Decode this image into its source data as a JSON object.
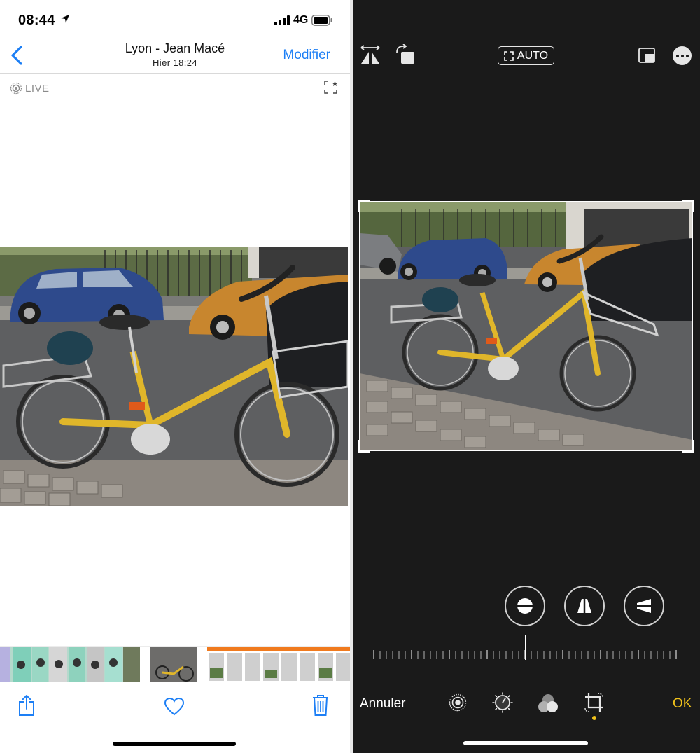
{
  "left": {
    "status": {
      "time": "08:44",
      "network": "4G"
    },
    "nav": {
      "title": "Lyon - Jean Macé",
      "subtitle": "Hier  18:24",
      "edit_label": "Modifier"
    },
    "live_label": "LIVE",
    "colors": {
      "accent": "#1d7ff5",
      "separator": "#d9d9d9"
    },
    "toolbar": {
      "icons": [
        "share-icon",
        "heart-icon",
        "trash-icon"
      ]
    }
  },
  "right": {
    "auto_label": "AUTO",
    "cancel_label": "Annuler",
    "ok_label": "OK",
    "colors": {
      "background": "#1a1a1a",
      "ok": "#f0c21b",
      "active_dot": "#f0c21b"
    },
    "adjust_tools": [
      "straighten-icon",
      "vertical-perspective-icon",
      "horizontal-perspective-icon"
    ],
    "edit_tabs": [
      "live-icon",
      "adjust-dial-icon",
      "filters-icon",
      "crop-icon"
    ],
    "active_tab": "crop-icon"
  }
}
